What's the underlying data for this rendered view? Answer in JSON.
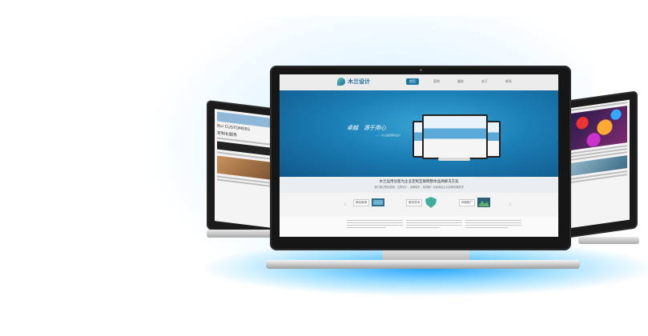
{
  "site": {
    "logo_text": "木兰设计",
    "nav_items": [
      "首页",
      "案例",
      "服务",
      "关于",
      "联系"
    ],
    "hero_title": "卓越　源于用心",
    "hero_sub": "—— 木兰品牌策划设计",
    "slogan_main": "木兰运用创意为企业定制互联网整体品牌解决方案",
    "slogan_sub": "我们通过策划营销、互联设计、品牌维护、营销推广全面满足企业品牌传播需求",
    "circle_icons": [
      "☆",
      "◎",
      "✎",
      "⚑",
      "✉"
    ],
    "services": [
      {
        "label": "精品案例"
      },
      {
        "label": "服务咨询"
      },
      {
        "label": "网络推广"
      }
    ]
  },
  "left_screen": {
    "header": "Bui CUSTOMERS",
    "line1": "定制化服务"
  },
  "icons": {
    "prev": "arrow-left-icon",
    "next": "arrow-right-icon"
  },
  "colors": {
    "accent": "#1c76a6",
    "hero": "#1b7fb5",
    "glow": "#00a0ff"
  }
}
